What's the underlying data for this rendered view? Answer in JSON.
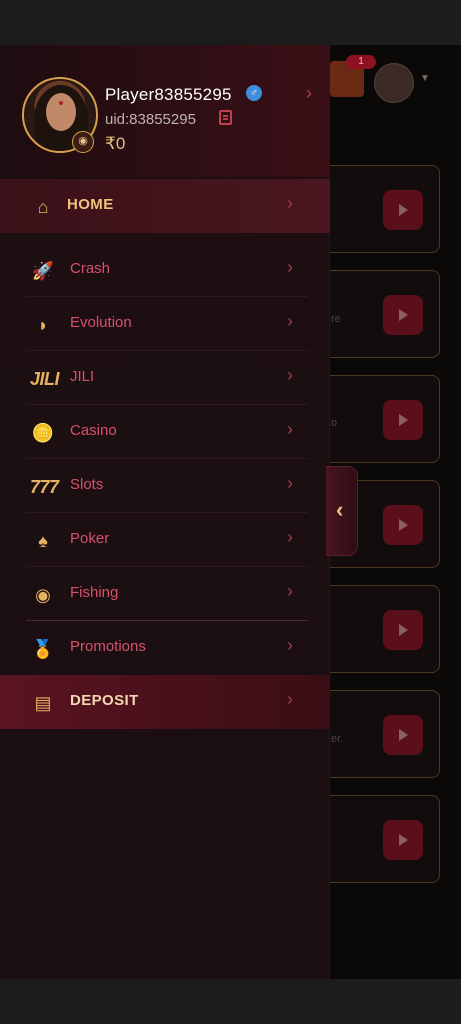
{
  "profile": {
    "player_name": "Player83855295",
    "uid": "uid:83855295",
    "balance": "₹0",
    "gender_icon": "male-icon"
  },
  "menu": [
    {
      "label": "HOME",
      "icon": "home-icon"
    },
    {
      "label": "Crash",
      "icon": "rocket-icon"
    },
    {
      "label": "Evolution",
      "icon": "evolution-icon"
    },
    {
      "label": "JILI",
      "icon": "jili-logo",
      "icon_text": "JILI"
    },
    {
      "label": "Casino",
      "icon": "coins-icon"
    },
    {
      "label": "Slots",
      "icon": "slots-777-icon",
      "icon_text": "777"
    },
    {
      "label": "Poker",
      "icon": "spade-icon"
    },
    {
      "label": "Fishing",
      "icon": "fish-icon"
    },
    {
      "label": "Promotions",
      "icon": "medal-icon"
    },
    {
      "label": "DEPOSIT",
      "icon": "wallet-icon"
    }
  ],
  "background": {
    "gift_badge": "1",
    "card_texts": [
      "re",
      "o",
      "er."
    ]
  },
  "colors": {
    "accent_gold": "#e4b260",
    "menu_text": "#d8506b",
    "home_text": "#f2c27a",
    "drawer_bg": "#1b0d10"
  }
}
